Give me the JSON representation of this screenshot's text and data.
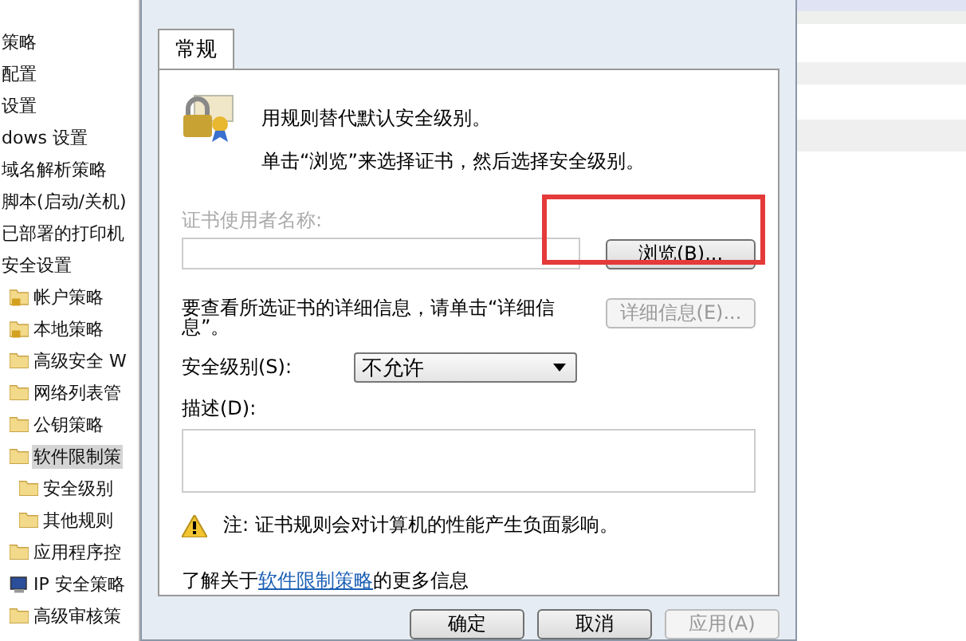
{
  "tree": {
    "items": [
      {
        "label": "策略",
        "selected": false
      },
      {
        "label": "配置",
        "selected": false
      },
      {
        "label": "设置",
        "selected": false
      },
      {
        "label": "dows 设置",
        "selected": false
      },
      {
        "label": "域名解析策略",
        "selected": false
      },
      {
        "label": "脚本(启动/关机)",
        "selected": false
      },
      {
        "label": "已部署的打印机",
        "selected": false
      },
      {
        "label": "安全设置",
        "selected": false,
        "children": [
          {
            "label": "帐户策略",
            "kind": "locked",
            "selected": false
          },
          {
            "label": "本地策略",
            "kind": "locked",
            "selected": false
          },
          {
            "label": "高级安全 W",
            "kind": "folder",
            "selected": false
          },
          {
            "label": "网络列表管",
            "kind": "folder",
            "selected": false
          },
          {
            "label": "公钥策略",
            "kind": "folder",
            "selected": false
          },
          {
            "label": "软件限制策",
            "kind": "folder",
            "selected": true,
            "children": [
              {
                "label": "安全级别",
                "kind": "folder",
                "selected": false
              },
              {
                "label": "其他规则",
                "kind": "folder",
                "selected": false
              }
            ]
          },
          {
            "label": "应用程序控",
            "kind": "folder",
            "selected": false
          },
          {
            "label": "IP 安全策略",
            "kind": "computer",
            "selected": false
          },
          {
            "label": "高级审核策",
            "kind": "folder",
            "selected": false
          }
        ]
      }
    ]
  },
  "dialog": {
    "tabs": [
      {
        "label": "常规",
        "selected": true
      }
    ],
    "intro": [
      "用规则替代默认安全级别。",
      "单击“浏览”来选择证书，然后选择安全级别。"
    ],
    "subject": {
      "label": "证书使用者名称:",
      "disabled": true
    },
    "browse_button": {
      "label": "浏览(B)...",
      "disabled": false,
      "highlighted": true
    },
    "details_text": "要查看所选证书的详细信息，请单击“详细信息”。",
    "details_button": {
      "label": "详细信息(E)...",
      "disabled": true
    },
    "security_level": {
      "label": "安全级别(S):",
      "value": "不允许"
    },
    "description": {
      "label": "描述(D):"
    },
    "warning": "注: 证书规则会对计算机的性能产生负面影响。",
    "more_info": {
      "before": "了解关于",
      "link": "软件限制策略",
      "after": "的更多信息"
    },
    "buttons": [
      {
        "label": "确定",
        "disabled": false
      },
      {
        "label": "取消",
        "disabled": false
      },
      {
        "label": "应用(A)",
        "disabled": true
      }
    ]
  }
}
